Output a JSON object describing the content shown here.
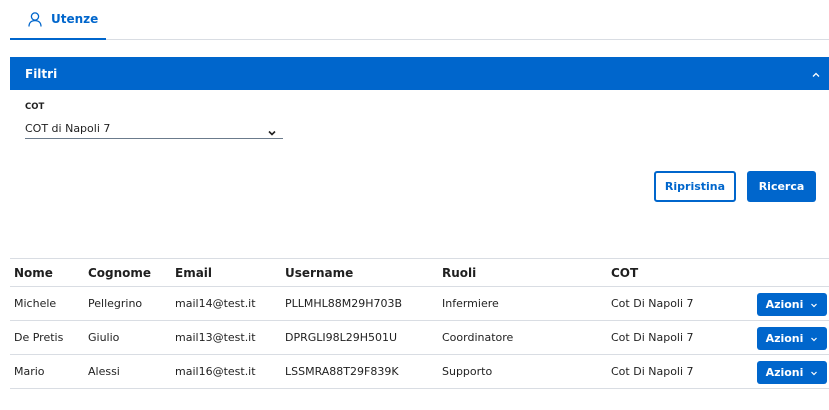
{
  "tabs": [
    {
      "label": "Utenze",
      "icon": "user-icon"
    }
  ],
  "filters": {
    "title": "Filtri",
    "cot_label": "COT",
    "cot_value": "COT di Napoli 7"
  },
  "buttons": {
    "reset_label": "Ripristina",
    "search_label": "Ricerca"
  },
  "table": {
    "columns": [
      "Nome",
      "Cognome",
      "Email",
      "Username",
      "Ruoli",
      "COT"
    ],
    "action_label": "Azioni",
    "rows": [
      [
        "Michele",
        "Pellegrino",
        "mail14@test.it",
        "PLLMHL88M29H703B",
        "Infermiere",
        "Cot Di Napoli 7"
      ],
      [
        "De Pretis",
        "Giulio",
        "mail13@test.it",
        "DPRGLI98L29H501U",
        "Coordinatore",
        "Cot Di Napoli 7"
      ],
      [
        "Mario",
        "Alessi",
        "mail16@test.it",
        "LSSMRA88T29F839K",
        "Supporto",
        "Cot Di Napoli 7"
      ]
    ]
  },
  "colors": {
    "primary": "#0066cc",
    "border": "#d9dde3"
  }
}
